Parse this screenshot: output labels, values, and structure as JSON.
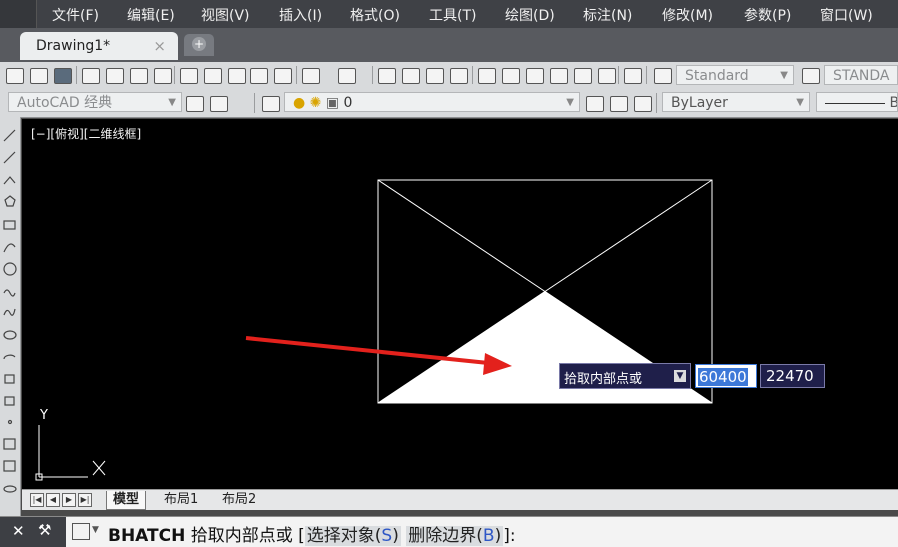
{
  "menu": [
    "文件(F)",
    "编辑(E)",
    "视图(V)",
    "插入(I)",
    "格式(O)",
    "工具(T)",
    "绘图(D)",
    "标注(N)",
    "修改(M)",
    "参数(P)",
    "窗口(W)"
  ],
  "tabs": {
    "active": "Drawing1*",
    "close": "×",
    "new": "+"
  },
  "toolbar": {
    "text_style": "Standard",
    "dim_style": "STANDA",
    "workspace": "AutoCAD 经典",
    "layer": "0",
    "color": "ByLayer",
    "linetype": "B"
  },
  "viewport": {
    "label": "[−][俯视][二维线框]",
    "ucs_y": "Y",
    "ucs_x": "X"
  },
  "layout_tabs": [
    "模型",
    "布局1",
    "布局2"
  ],
  "dynamic_input": {
    "prompt": "拾取内部点或",
    "x_value": "60400",
    "y_value": "22470"
  },
  "command": {
    "name": "BHATCH",
    "prompt": "拾取内部点或",
    "open_bracket": "[",
    "opt1_label": "选择对象(",
    "opt1_key": "S",
    "opt1_end": ")",
    "opt2_label": "删除边界(",
    "opt2_key": "B",
    "opt2_end": ")",
    "close": "]:"
  },
  "colors": {
    "canvas": "#000000",
    "arrow": "#e3211c",
    "hatch": "#ffffff",
    "key": "#2e57c6"
  }
}
